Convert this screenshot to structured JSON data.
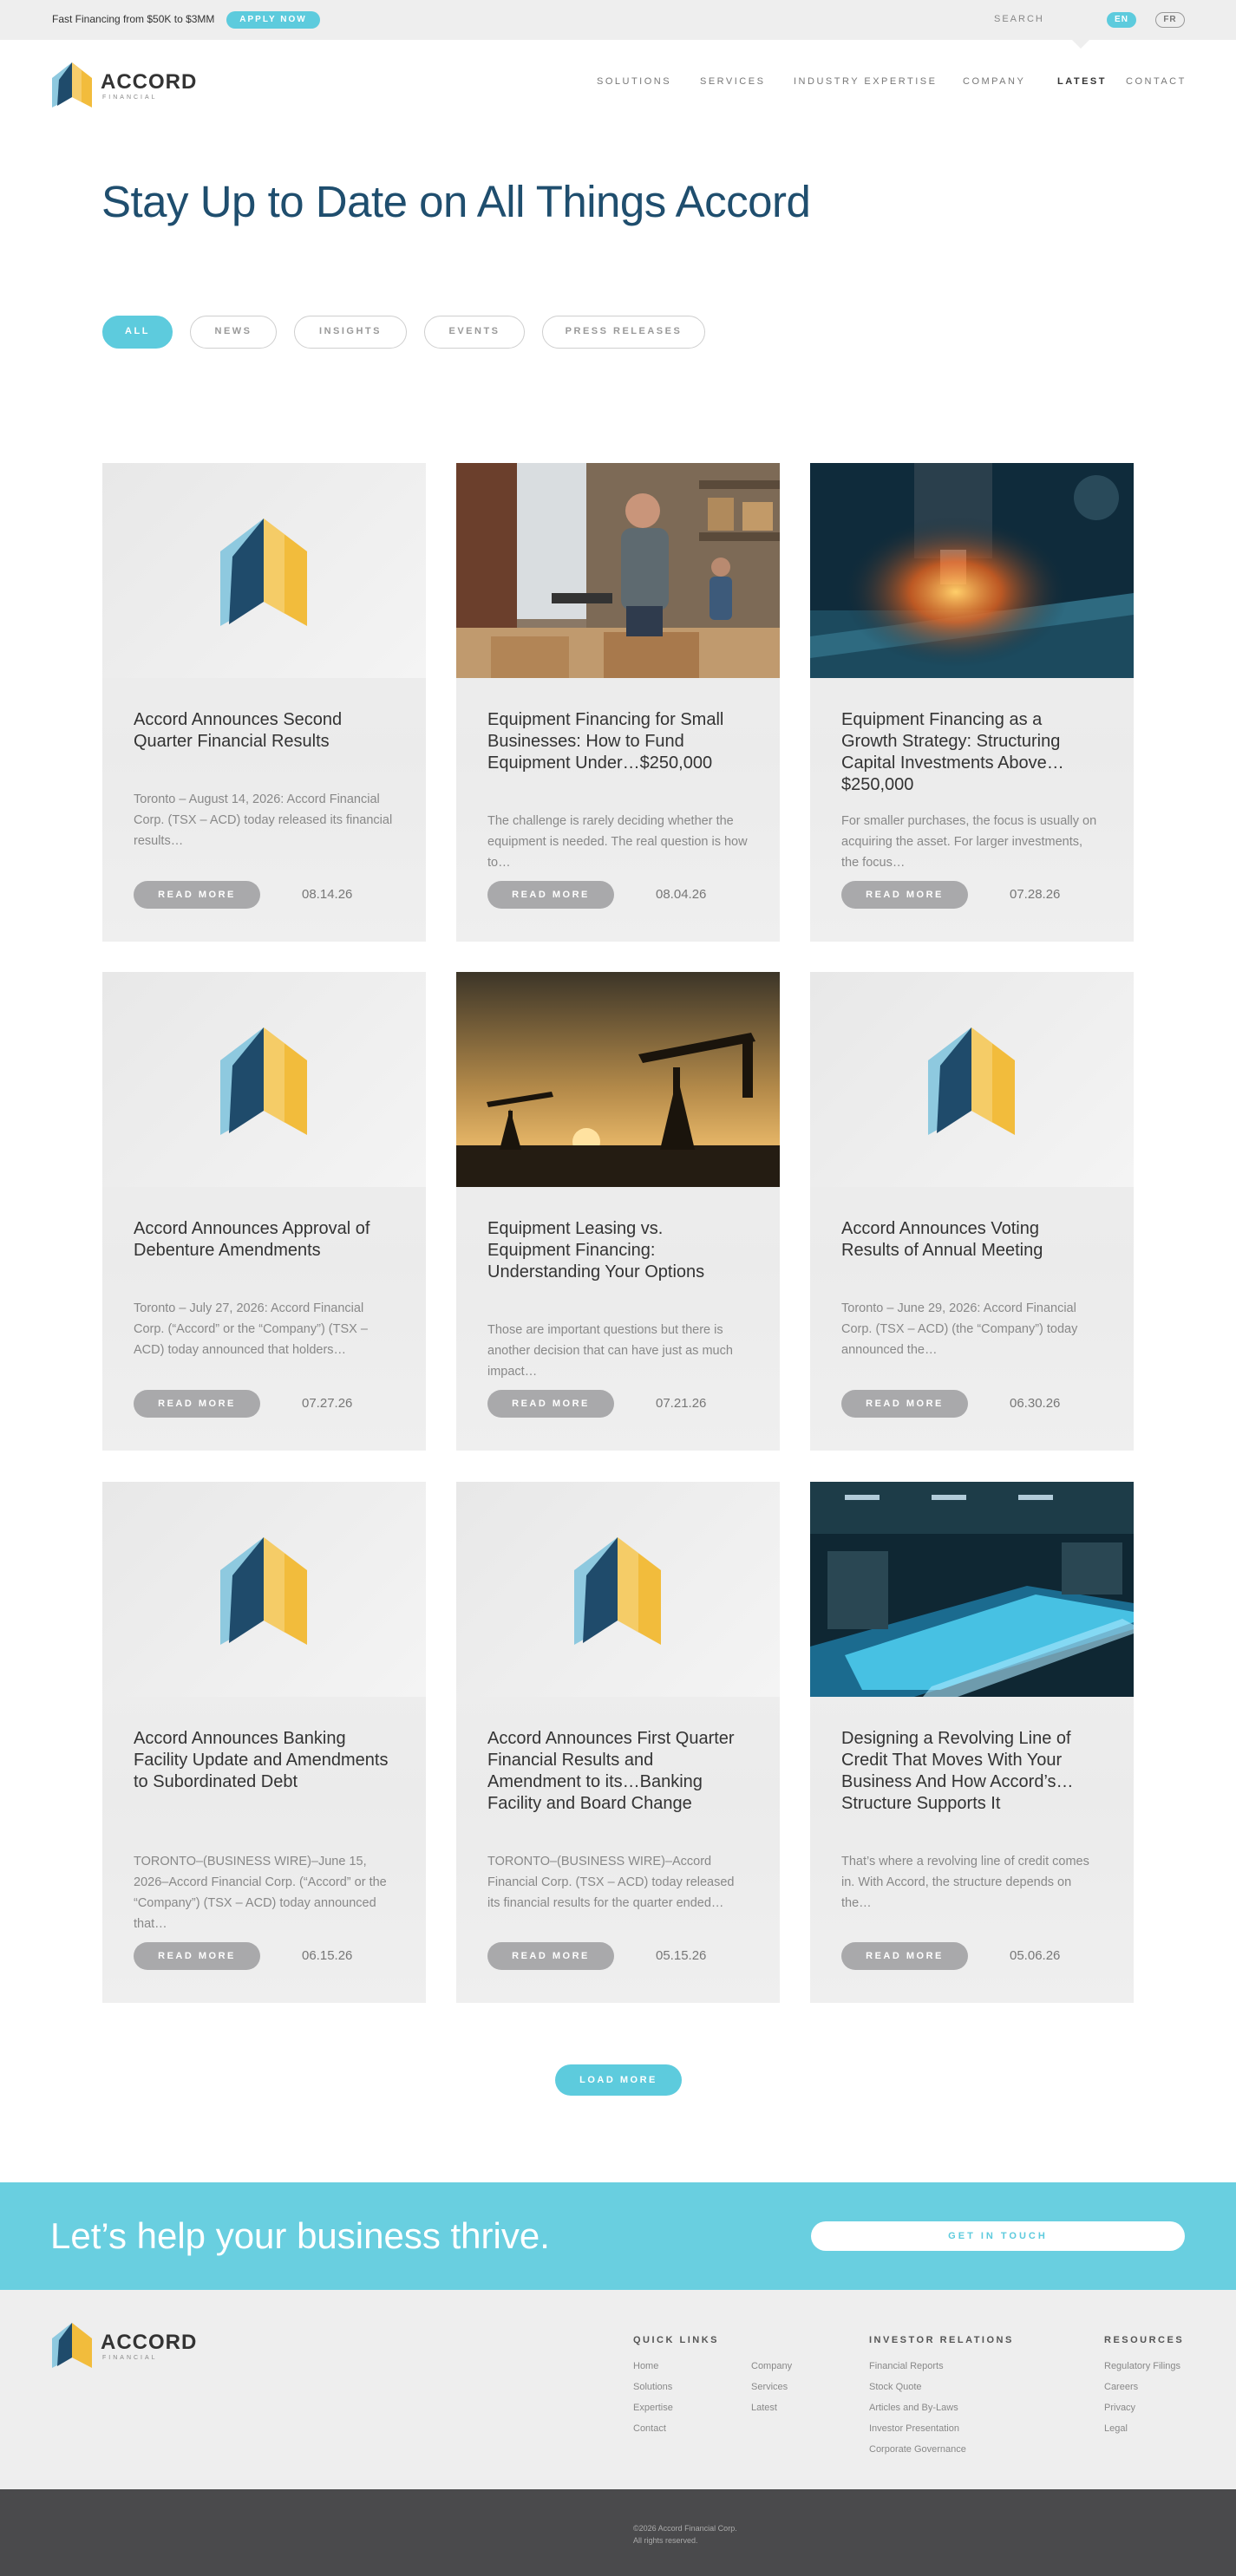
{
  "topbar": {
    "promo": "Fast Financing from $50K to $3MM",
    "apply_label": "APPLY NOW",
    "search_label": "SEARCH",
    "lang_en": "EN",
    "lang_fr": "FR"
  },
  "header": {
    "brand": "ACCORD",
    "brand_sub": "FINANCIAL",
    "nav": [
      "SOLUTIONS",
      "SERVICES",
      "INDUSTRY EXPERTISE",
      "COMPANY",
      "LATEST",
      "CONTACT"
    ],
    "active_nav": "LATEST"
  },
  "page_title": "Stay Up to Date on All Things Accord",
  "filters": [
    "ALL",
    "NEWS",
    "INSIGHTS",
    "EVENTS",
    "PRESS RELEASES"
  ],
  "cards": [
    {
      "image": "accord-logo",
      "title": "Accord Announces Second Quarter Financial Results",
      "desc": "Toronto – August 14, 2026: Accord Financial Corp. (TSX – ACD) today released its financial results…",
      "read_more": "READ MORE",
      "date": "08.14.26"
    },
    {
      "image": "photo-warehouse-worker",
      "title": "Equipment Financing for Small Businesses: How to Fund Equipment Under…$250,000",
      "desc": "The challenge is rarely deciding whether the equipment is needed. The real question is how to…",
      "read_more": "READ MORE",
      "date": "08.04.26"
    },
    {
      "image": "photo-cnc-machine",
      "title": "Equipment Financing as a Growth Strategy: Structuring Capital Investments Above…$250,000",
      "desc": "For smaller purchases, the focus is usually on acquiring the asset. For larger investments, the focus…",
      "read_more": "READ MORE",
      "date": "07.28.26"
    },
    {
      "image": "accord-logo",
      "title": "Accord Announces Approval of Debenture Amendments",
      "desc": "Toronto – July 27, 2026: Accord Financial Corp. (“Accord” or the “Company”) (TSX – ACD) today announced that holders…",
      "read_more": "READ MORE",
      "date": "07.27.26"
    },
    {
      "image": "photo-oil-pumpjacks",
      "title": "Equipment Leasing vs. Equipment Financing: Understanding Your Options",
      "desc": "Those are important questions but there is another decision that can have just as much impact…",
      "read_more": "READ MORE",
      "date": "07.21.26"
    },
    {
      "image": "accord-logo",
      "title": "Accord Announces Voting Results of Annual Meeting",
      "desc": "Toronto – June 29, 2026: Accord Financial Corp. (TSX – ACD) (the “Company”) today announced the…",
      "read_more": "READ MORE",
      "date": "06.30.26"
    },
    {
      "image": "accord-logo",
      "title": "Accord Announces Banking Facility Update and Amendments to Subordinated Debt",
      "desc": "TORONTO–(BUSINESS WIRE)–June 15, 2026–Accord Financial Corp. (“Accord” or the “Company”) (TSX – ACD) today announced that…",
      "read_more": "READ MORE",
      "date": "06.15.26"
    },
    {
      "image": "accord-logo",
      "title": "Accord Announces First Quarter Financial Results and Amendment to its…Banking Facility and Board Change",
      "desc": "TORONTO–(BUSINESS WIRE)–Accord Financial Corp. (TSX – ACD) today released its financial results for the quarter ended…",
      "read_more": "READ MORE",
      "date": "05.15.26"
    },
    {
      "image": "photo-conveyor-line",
      "title": "Designing a Revolving Line of Credit That Moves With Your Business And How Accord’s…Structure Supports It",
      "desc": "That’s where a revolving line of credit comes in. With Accord, the structure depends on the…",
      "read_more": "READ MORE",
      "date": "05.06.26"
    }
  ],
  "load_more": "LOAD MORE",
  "cta": {
    "text": "Let’s help your business thrive.",
    "button": "GET IN TOUCH"
  },
  "footer": {
    "brand": "ACCORD",
    "brand_sub": "FINANCIAL",
    "quick_links_title": "QUICK LINKS",
    "quick_links_col1": [
      "Home",
      "Solutions",
      "Expertise",
      "Contact"
    ],
    "quick_links_col2": [
      "Company",
      "Services",
      "Latest"
    ],
    "investor_title": "INVESTOR RELATIONS",
    "investor_links": [
      "Financial Reports",
      "Stock Quote",
      "Articles and By-Laws",
      "Investor Presentation",
      "Corporate Governance"
    ],
    "resources_title": "RESOURCES",
    "resources_links": [
      "Regulatory Filings",
      "Careers",
      "Privacy",
      "Legal"
    ],
    "copyright": "©2026 Accord Financial Corp.",
    "rights": "All rights reserved."
  },
  "colors": {
    "accent": "#5dcbdd",
    "brand_dark": "#1f4e6e",
    "logo_navy": "#1f4b6b",
    "logo_blue": "#8ec9df",
    "logo_yellow": "#f2bc3c"
  }
}
